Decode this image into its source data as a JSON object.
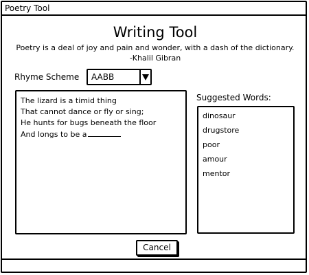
{
  "window": {
    "title": "Poetry Tool"
  },
  "header": {
    "title": "Writing Tool",
    "quote": "Poetry is a deal of joy and pain and wonder, with a dash of the dictionary.",
    "quote_author": "-Khalil Gibran"
  },
  "rhyme": {
    "label": "Rhyme Scheme",
    "selected": "AABB",
    "dropdown_icon": "triangle-down-icon"
  },
  "editor": {
    "lines": [
      "The lizard is a timid thing",
      "That cannot dance or fly or sing;",
      "He hunts for bugs beneath the floor",
      "And longs to be a"
    ]
  },
  "suggestions": {
    "label": "Suggested Words:",
    "words": [
      "dinosaur",
      "drugstore",
      "poor",
      "amour",
      "mentor"
    ]
  },
  "actions": {
    "cancel_label": "Cancel"
  }
}
